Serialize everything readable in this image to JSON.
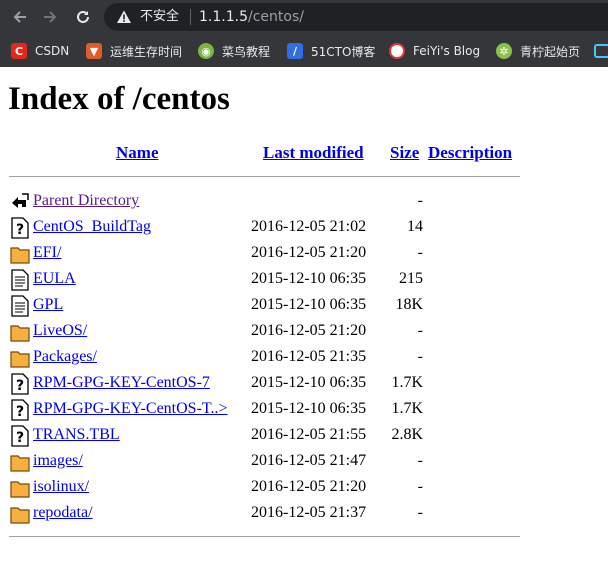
{
  "browser": {
    "security_label": "不安全",
    "url_host": "1.1.1.5",
    "url_path": "/centos/",
    "bookmarks": [
      {
        "label": "CSDN",
        "icon": "csdn-icon",
        "color": "#e3281b",
        "glyph": "C"
      },
      {
        "label": "运维生存时间",
        "icon": "yunwei-icon",
        "color": "#e05a2b",
        "glyph": "▼"
      },
      {
        "label": "菜鸟教程",
        "icon": "runoob-icon",
        "color": "#7cb342",
        "glyph": "◉"
      },
      {
        "label": "51CTO博客",
        "icon": "51cto-icon",
        "color": "#2f6fe4",
        "glyph": "/"
      },
      {
        "label": "FeiYi's Blog",
        "icon": "pokeball-icon",
        "color": "#e53935",
        "glyph": "●"
      },
      {
        "label": "青柠起始页",
        "icon": "qingning-icon",
        "color": "#8bc34a",
        "glyph": "✲"
      }
    ]
  },
  "page": {
    "title": "Index of /centos",
    "columns": {
      "name": "Name",
      "last_modified": "Last modified",
      "size": "Size",
      "description": "Description"
    },
    "entries": [
      {
        "name": "Parent Directory",
        "modified": "",
        "size": "-",
        "icon": "back-icon"
      },
      {
        "name": "CentOS_BuildTag",
        "modified": "2016-12-05 21:02",
        "size": "14",
        "icon": "unknown-file-icon"
      },
      {
        "name": "EFI/",
        "modified": "2016-12-05 21:20",
        "size": "-",
        "icon": "folder-icon"
      },
      {
        "name": "EULA",
        "modified": "2015-12-10 06:35",
        "size": "215",
        "icon": "text-file-icon"
      },
      {
        "name": "GPL",
        "modified": "2015-12-10 06:35",
        "size": "18K",
        "icon": "text-file-icon"
      },
      {
        "name": "LiveOS/",
        "modified": "2016-12-05 21:20",
        "size": "-",
        "icon": "folder-icon"
      },
      {
        "name": "Packages/",
        "modified": "2016-12-05 21:35",
        "size": "-",
        "icon": "folder-icon"
      },
      {
        "name": "RPM-GPG-KEY-CentOS-7",
        "modified": "2015-12-10 06:35",
        "size": "1.7K",
        "icon": "unknown-file-icon"
      },
      {
        "name": "RPM-GPG-KEY-CentOS-T..>",
        "modified": "2015-12-10 06:35",
        "size": "1.7K",
        "icon": "unknown-file-icon"
      },
      {
        "name": "TRANS.TBL",
        "modified": "2016-12-05 21:55",
        "size": "2.8K",
        "icon": "unknown-file-icon"
      },
      {
        "name": "images/",
        "modified": "2016-12-05 21:47",
        "size": "-",
        "icon": "folder-icon"
      },
      {
        "name": "isolinux/",
        "modified": "2016-12-05 21:20",
        "size": "-",
        "icon": "folder-icon"
      },
      {
        "name": "repodata/",
        "modified": "2016-12-05 21:37",
        "size": "-",
        "icon": "folder-icon"
      }
    ]
  }
}
